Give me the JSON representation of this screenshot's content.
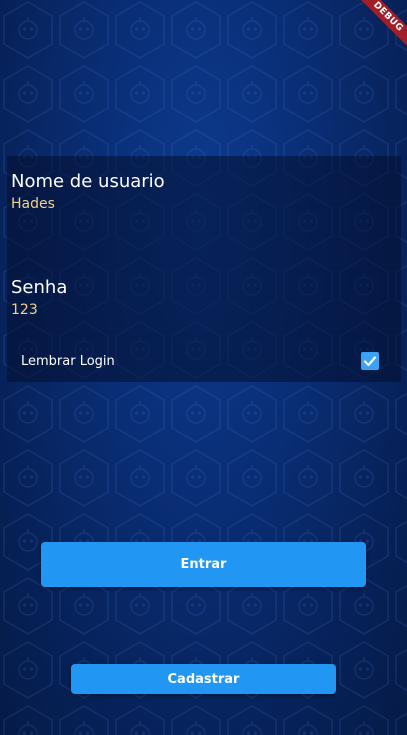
{
  "debug_banner": {
    "label": "DEBUG"
  },
  "login_form": {
    "username": {
      "label": "Nome de usuario",
      "value": "Hades"
    },
    "password": {
      "label": "Senha",
      "value": "123"
    },
    "remember": {
      "label": "Lembrar Login",
      "checked": true
    }
  },
  "actions": {
    "enter_label": "Entrar",
    "register_label": "Cadastrar"
  },
  "colors": {
    "background": "#0a2f78",
    "accent": "#2196f3",
    "value_text": "#f2d28f",
    "checkbox": "#3aa3f5"
  }
}
